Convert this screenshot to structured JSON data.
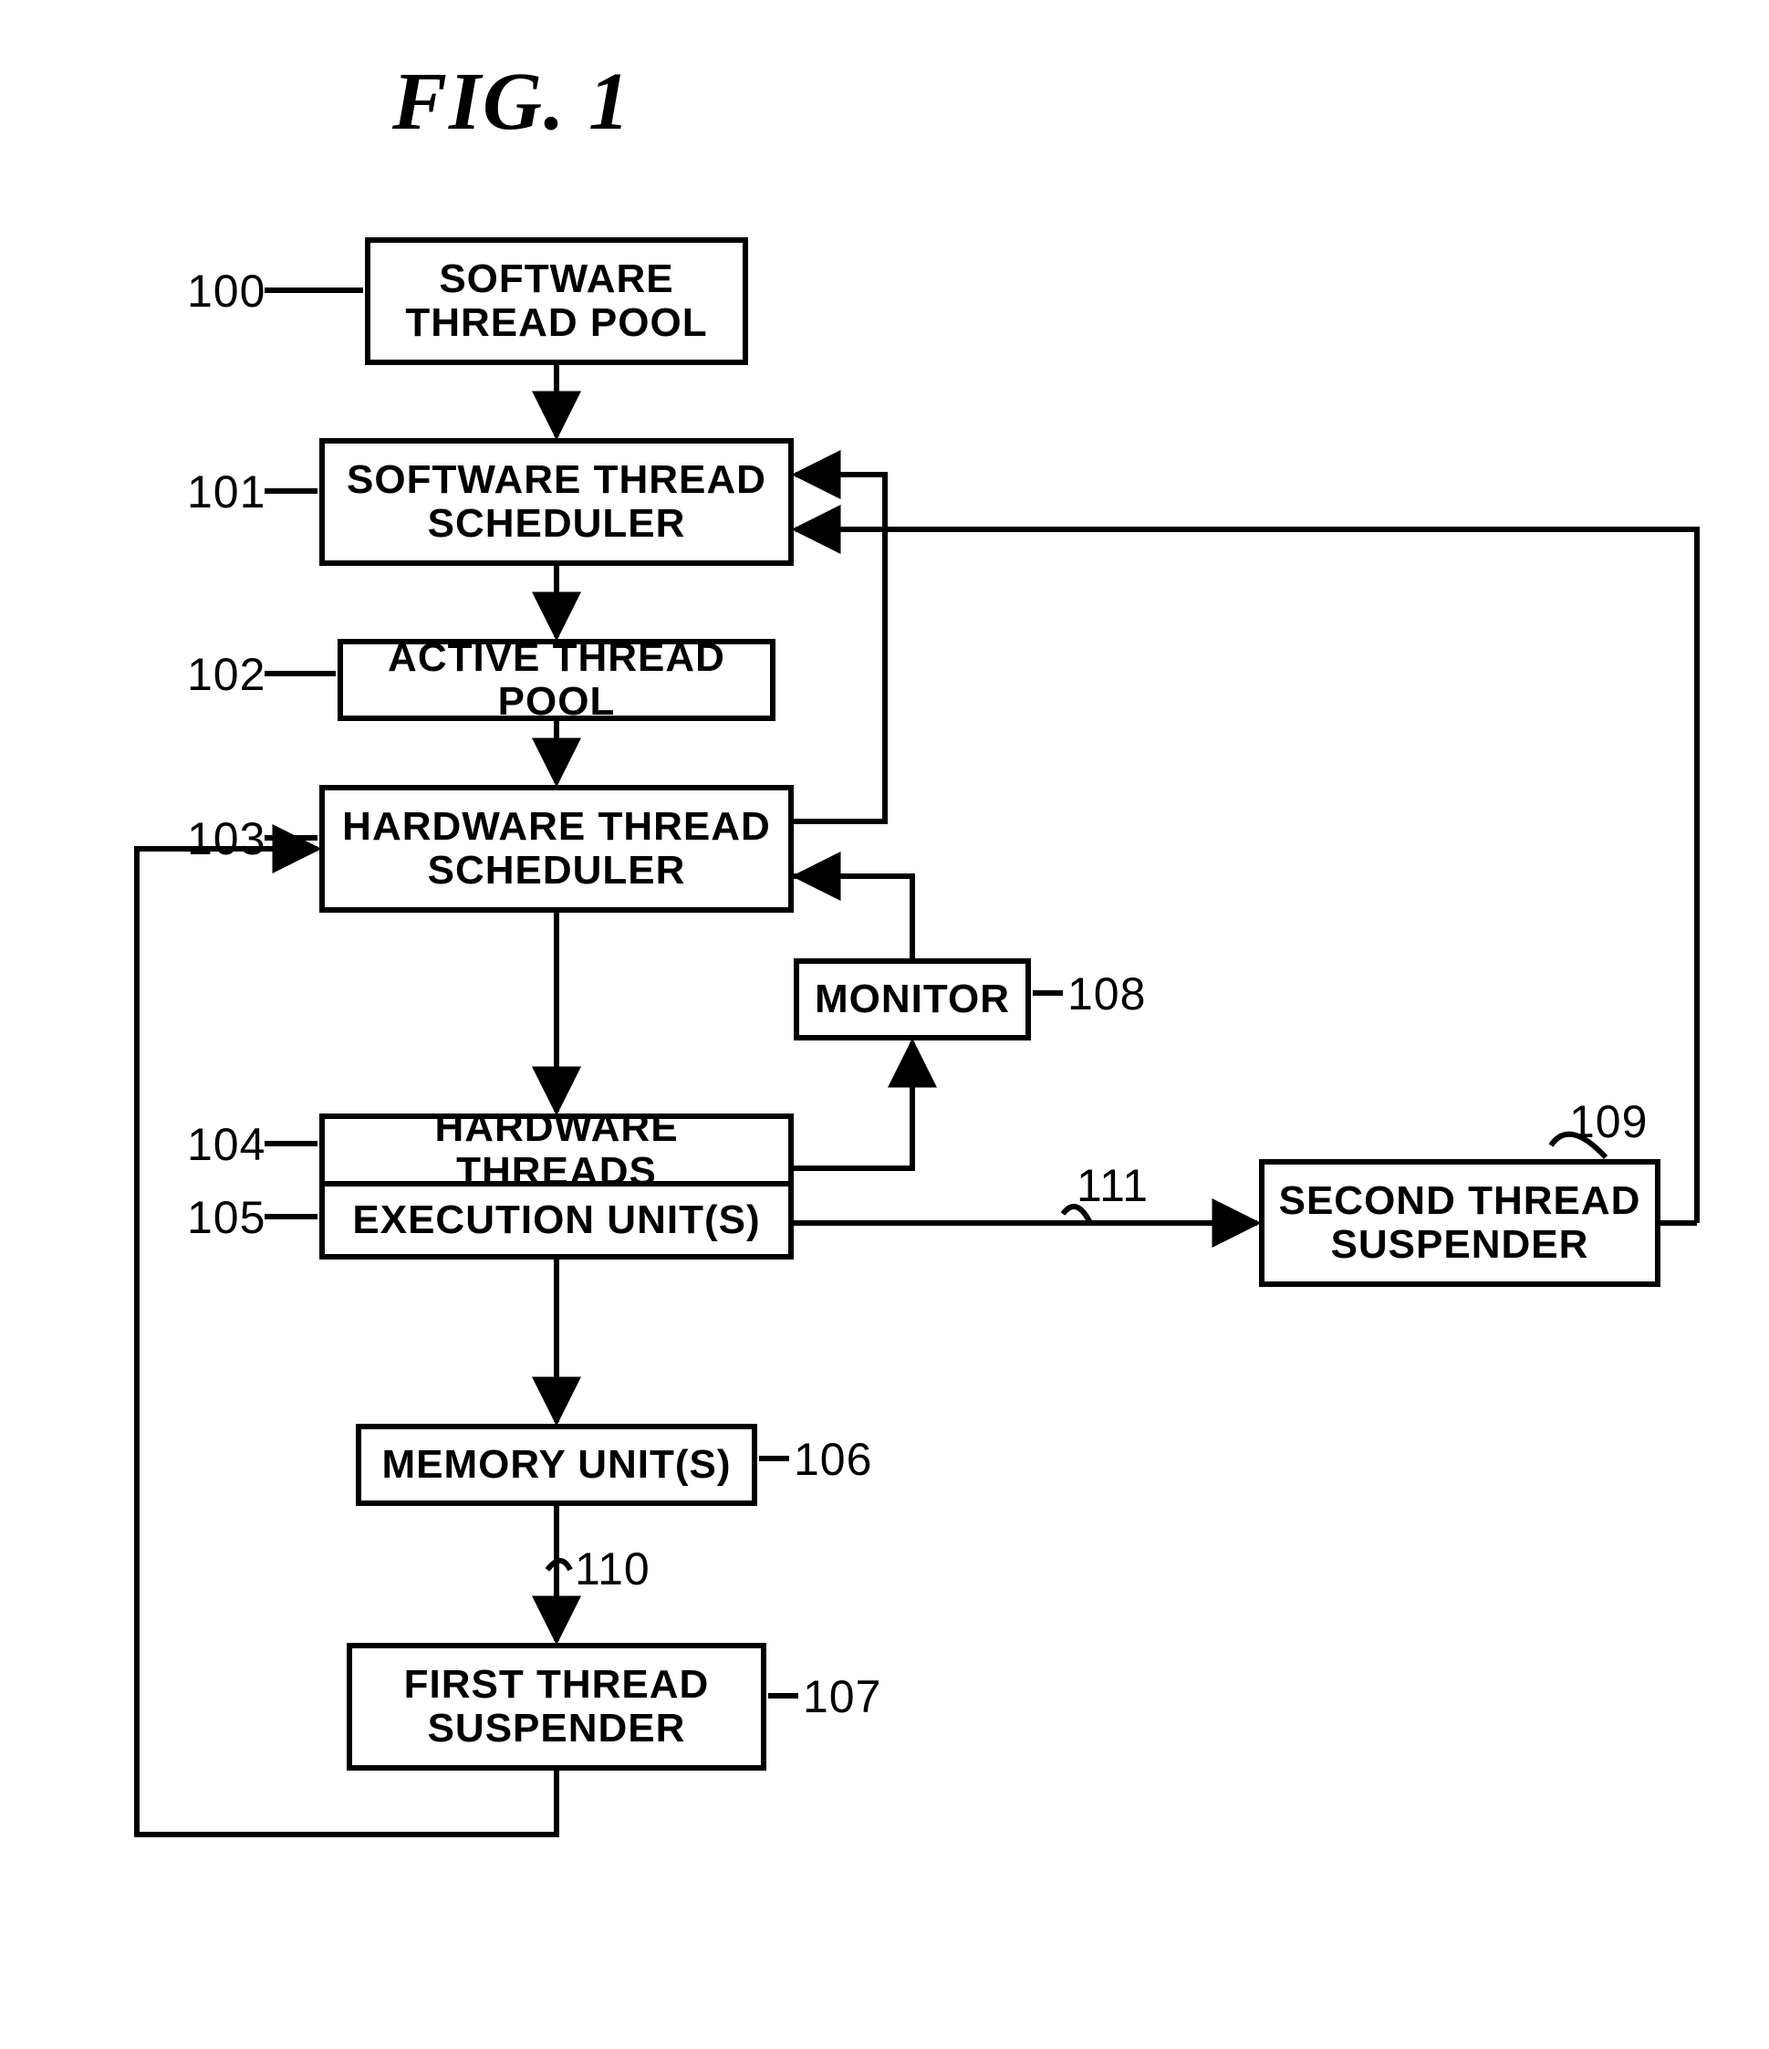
{
  "figure": {
    "title": "FIG.  1"
  },
  "blocks": {
    "b100": "SOFTWARE\nTHREAD POOL",
    "b101": "SOFTWARE THREAD\nSCHEDULER",
    "b102": "ACTIVE THREAD POOL",
    "b103": "HARDWARE THREAD\nSCHEDULER",
    "b104": "HARDWARE THREADS",
    "b105": "EXECUTION UNIT(S)",
    "b106": "MEMORY UNIT(S)",
    "b107": "FIRST THREAD\nSUSPENDER",
    "b108": "MONITOR",
    "b109": "SECOND THREAD\nSUSPENDER"
  },
  "labels": {
    "l100": "100",
    "l101": "101",
    "l102": "102",
    "l103": "103",
    "l104": "104",
    "l105": "105",
    "l106": "106",
    "l107": "107",
    "l108": "108",
    "l109": "109",
    "l110": "110",
    "l111": "111"
  },
  "chart_data": {
    "type": "diagram",
    "title": "FIG. 1",
    "nodes": [
      {
        "id": "100",
        "label": "SOFTWARE THREAD POOL"
      },
      {
        "id": "101",
        "label": "SOFTWARE THREAD SCHEDULER"
      },
      {
        "id": "102",
        "label": "ACTIVE THREAD POOL"
      },
      {
        "id": "103",
        "label": "HARDWARE THREAD SCHEDULER"
      },
      {
        "id": "104",
        "label": "HARDWARE THREADS"
      },
      {
        "id": "105",
        "label": "EXECUTION UNIT(S)"
      },
      {
        "id": "106",
        "label": "MEMORY UNIT(S)"
      },
      {
        "id": "107",
        "label": "FIRST THREAD SUSPENDER"
      },
      {
        "id": "108",
        "label": "MONITOR"
      },
      {
        "id": "109",
        "label": "SECOND THREAD SUSPENDER"
      }
    ],
    "edges": [
      {
        "from": "100",
        "to": "101"
      },
      {
        "from": "101",
        "to": "102"
      },
      {
        "from": "102",
        "to": "103"
      },
      {
        "from": "103",
        "to": "104"
      },
      {
        "from": "105",
        "to": "106"
      },
      {
        "from": "106",
        "to": "107",
        "label": "110"
      },
      {
        "from": "107",
        "to": "103"
      },
      {
        "from": "103",
        "to": "101"
      },
      {
        "from": "105",
        "to": "108"
      },
      {
        "from": "108",
        "to": "103"
      },
      {
        "from": "105",
        "to": "109",
        "label": "111"
      },
      {
        "from": "109",
        "to": "101"
      }
    ]
  }
}
